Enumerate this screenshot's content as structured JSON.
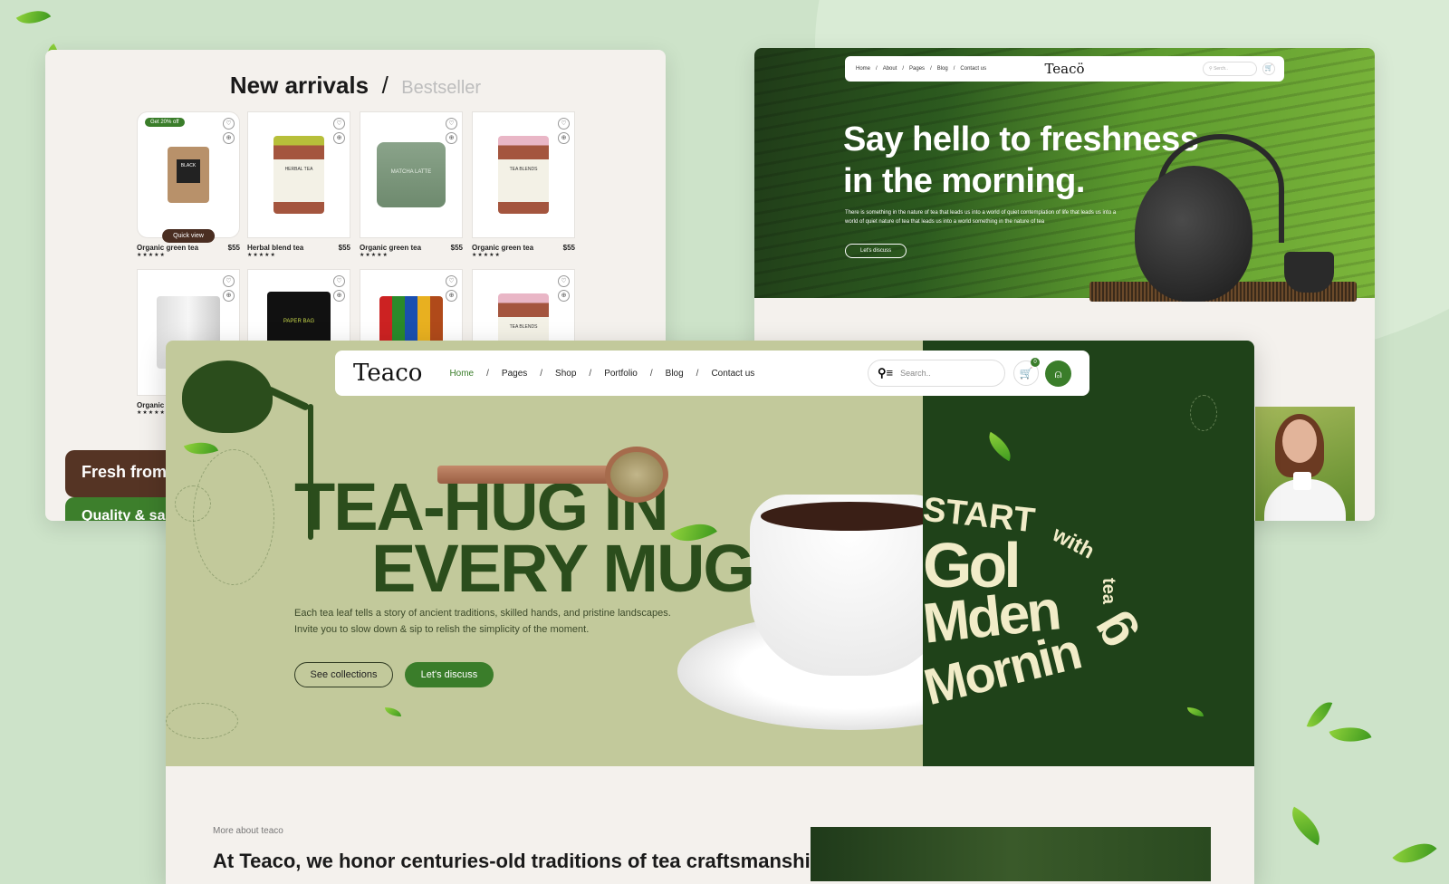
{
  "panel_shop": {
    "tabs": {
      "active": "New arrivals",
      "separator": "/",
      "inactive": "Bestseller"
    },
    "products": [
      {
        "name": "Organic green tea",
        "price": "$55",
        "rating": "★★★★★",
        "badge": "Get 20% off",
        "quick_view": "Quick view",
        "label": "BLACK"
      },
      {
        "name": "Herbal blend tea",
        "price": "$55",
        "rating": "★★★★★",
        "label": "HERBAL TEA"
      },
      {
        "name": "Organic green tea",
        "price": "$55",
        "rating": "★★★★★",
        "label": "MATCHA LATTE"
      },
      {
        "name": "Organic green tea",
        "price": "$55",
        "rating": "★★★★★",
        "label": "TEA BLENDS"
      },
      {
        "name": "Organic green tea",
        "price": "",
        "rating": "★★★★★",
        "label": ""
      },
      {
        "name": "",
        "price": "",
        "rating": "",
        "label": "PAPER BAG"
      },
      {
        "name": "",
        "price": "",
        "rating": "",
        "label": ""
      },
      {
        "name": "",
        "price": "",
        "rating": "",
        "label": "TEA BLENDS"
      }
    ],
    "banner_fresh": "Fresh from t",
    "banner_quality": "Quality & sa"
  },
  "panel_hero2": {
    "nav": {
      "links": [
        "Home",
        "/",
        "About",
        "/",
        "Pages",
        "/",
        "Blog",
        "/",
        "Contact us"
      ],
      "logo": "Teacö",
      "search_placeholder": "Serch..",
      "cart_icon": "🛒"
    },
    "title_line1": "Say hello to freshness",
    "title_line2": "in the morning.",
    "description": "There is something in the nature of tea that leads us into a world of quiet contemplation of life that leads us into a world of quiet nature of tea that leads us into a world something in the nature of tea",
    "cta": "Let's discuss"
  },
  "panel_main": {
    "nav": {
      "logo": "Teaco",
      "links": [
        {
          "label": "Home",
          "active": true
        },
        {
          "label": "Pages",
          "active": false
        },
        {
          "label": "Shop",
          "active": false
        },
        {
          "label": "Portfolio",
          "active": false
        },
        {
          "label": "Blog",
          "active": false
        },
        {
          "label": "Contact us",
          "active": false
        }
      ],
      "separator": "/",
      "search_placeholder": "Search..",
      "cart_count": "0"
    },
    "headline_line1": "TEA-HUG IN",
    "headline_line2": "EVERY MUG",
    "description_line1": "Each tea leaf tells a story of ancient traditions, skilled hands, and pristine landscapes.",
    "description_line2": "Invite you to slow down & sip to relish the simplicity of the moment.",
    "btn_collections": "See collections",
    "btn_discuss": "Let's discuss",
    "tagline": {
      "start": "START",
      "with": "with",
      "tea": "tea",
      "gol": "Gol",
      "den": "Mden",
      "morning": "Mornin",
      "g": "g"
    },
    "more_label": "More about teaco",
    "about_text": "At Teaco, we honor centuries-old traditions of tea craftsmanship"
  },
  "colors": {
    "brand_green": "#3a7d2a",
    "dark_green": "#1f4219",
    "sage": "#c2c99b",
    "brown": "#553424"
  }
}
